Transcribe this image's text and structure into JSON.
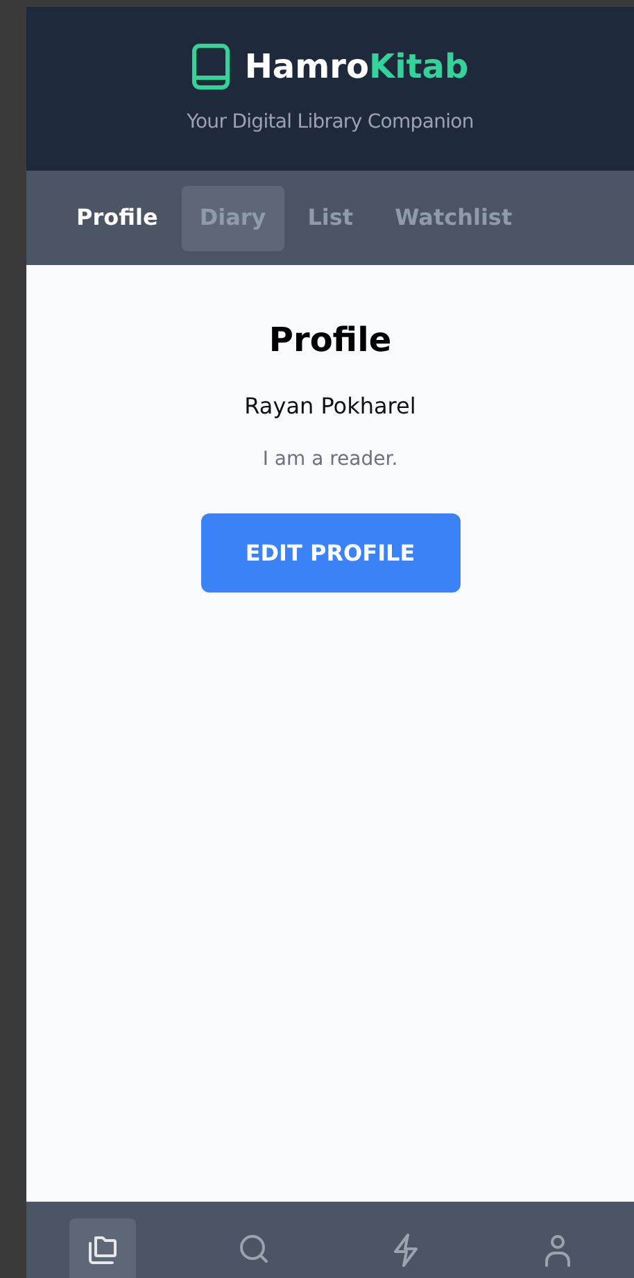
{
  "header": {
    "brand": [
      {
        "text": "Hamro",
        "kind": "plain"
      },
      {
        "text": "Kitab",
        "kind": "accent"
      }
    ],
    "tagline": "Your Digital Library Companion"
  },
  "tabs": [
    {
      "label": "Profile",
      "selected": true,
      "hovered": false
    },
    {
      "label": "Diary",
      "selected": false,
      "hovered": true
    },
    {
      "label": "List",
      "selected": false,
      "hovered": false
    },
    {
      "label": "Watchlist",
      "selected": false,
      "hovered": false
    }
  ],
  "profile": {
    "title": "Profile",
    "name": "Rayan Pokharel",
    "bio": "I am a reader.",
    "button": "EDIT PROFILE"
  },
  "bottom_nav": [
    {
      "kind": "library",
      "selected": true
    },
    {
      "kind": "search",
      "selected": false
    },
    {
      "kind": "activity",
      "selected": false
    },
    {
      "kind": "account",
      "selected": false
    }
  ]
}
